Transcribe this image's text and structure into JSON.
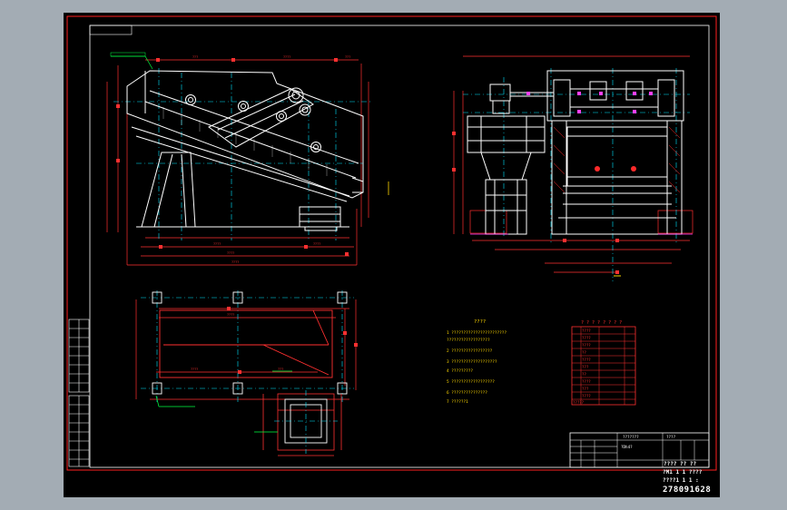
{
  "drawing_id": "278091628",
  "colors": {
    "viewport_bg": "#a3acb4",
    "paper": "#000000",
    "border": "#ff2020",
    "machine": "#ffffff",
    "dimension": "#ff3030",
    "centerline": "#00e5ff",
    "yellow": "#ffd800",
    "green": "#00ff40",
    "magenta": "#ff40ff",
    "hatch": "#ff2a2a"
  },
  "notes": {
    "title": "????",
    "lines": [
      "1 ???????????????????????",
      "  ??????????????????",
      "2 ?????????????????",
      "3 ???????????????????",
      "4 ?????????",
      "5 ??????????????????",
      "6 ???????????????",
      "7 ??????1"
    ]
  },
  "parts_table": {
    "title": "? ? ? ? ? ? ? ?",
    "rows": [
      "????",
      "????",
      "????",
      "??",
      "????",
      "???",
      "??",
      "????",
      "???",
      "????",
      "?????"
    ]
  },
  "title_block": {
    "project": "???????",
    "scale_label": "????",
    "drawing_name": "?Dh4?",
    "footer_line_1": "???? ?? ??",
    "footer_line_2": "?M1 1 1 ????",
    "footer_line_3": "????1 1 1 :"
  },
  "dims": {
    "top": [
      "???",
      "????",
      "???"
    ],
    "bottom": [
      "????",
      "????",
      "????",
      "????"
    ],
    "plan": [
      "????",
      "????",
      "???"
    ]
  }
}
